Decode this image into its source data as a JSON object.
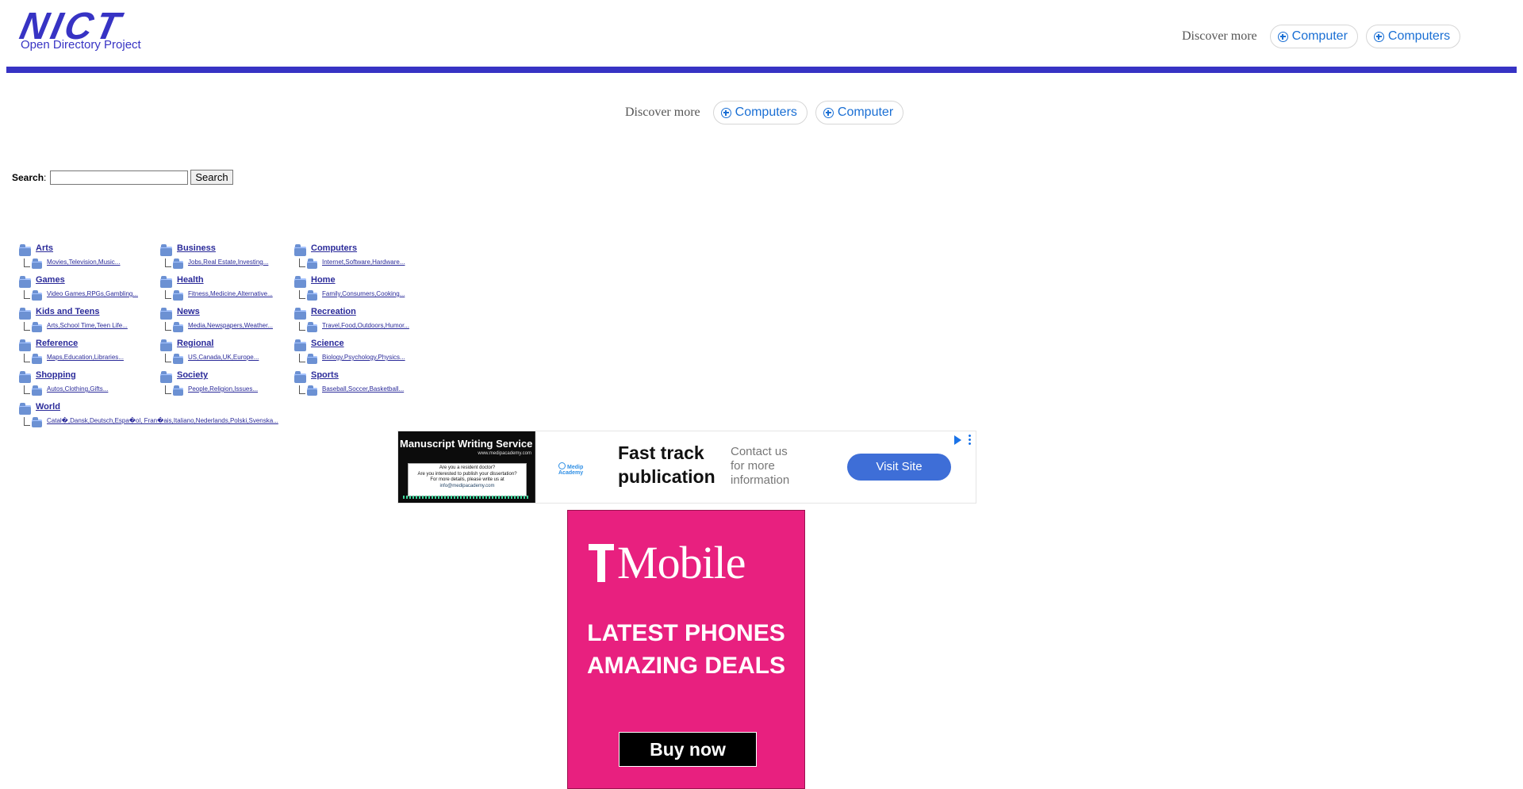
{
  "logo": {
    "wordmark": "NICT",
    "subtitle": "Open Directory Project"
  },
  "discover_top": {
    "label": "Discover more",
    "chips": [
      "Computer",
      "Computers"
    ]
  },
  "discover_mid": {
    "label": "Discover more",
    "chips": [
      "Computers",
      "Computer"
    ]
  },
  "search": {
    "label": "Search",
    "colon": ":",
    "input_value": "",
    "button": "Search"
  },
  "categories": [
    {
      "title": "Arts",
      "subs": "Movies,Television,Music..."
    },
    {
      "title": "Business",
      "subs": "Jobs,Real Estate,Investing..."
    },
    {
      "title": "Computers",
      "subs": "Internet,Software,Hardware..."
    },
    {
      "title": "Games",
      "subs": "Video Games,RPGs,Gambling..."
    },
    {
      "title": "Health",
      "subs": "Fitness,Medicine,Alternative..."
    },
    {
      "title": "Home",
      "subs": "Family,Consumers,Cooking..."
    },
    {
      "title": "Kids and Teens",
      "subs": "Arts,School Time,Teen Life..."
    },
    {
      "title": "News",
      "subs": "Media,Newspapers,Weather..."
    },
    {
      "title": "Recreation",
      "subs": "Travel,Food,Outdoors,Humor..."
    },
    {
      "title": "Reference",
      "subs": "Maps,Education,Libraries..."
    },
    {
      "title": "Regional",
      "subs": "US,Canada,UK,Europe..."
    },
    {
      "title": "Science",
      "subs": "Biology,Psychology,Physics..."
    },
    {
      "title": "Shopping",
      "subs": "Autos,Clothing,Gifts..."
    },
    {
      "title": "Society",
      "subs": "People,Religion,Issues..."
    },
    {
      "title": "Sports",
      "subs": "Baseball,Soccer,Basketball..."
    },
    {
      "title": "World",
      "subs": "Catal�,Dansk,Deutsch,Espa�ol, Fran�ais,Italiano,Nederlands,Polski,Svenska..."
    }
  ],
  "ad_banner": {
    "thumb_title": "Manuscript Writing Service",
    "thumb_url": "www.medipacademy.com",
    "thumb_lines": [
      "Are you a resident doctor?",
      "Are you interested to publish your dissertation?",
      "For more details, please write us at",
      "info@medipacademy.com"
    ],
    "small_logo": "Medip Academy",
    "headline": "Fast track publication",
    "description": "Contact us for more information",
    "cta": "Visit Site",
    "adchoices_icon": "adchoices-icon",
    "menu_icon": "kebab-icon"
  },
  "tmobile_ad": {
    "brand": "Mobile",
    "headline_1": "LATEST PHONES",
    "headline_2": "AMAZING DEALS",
    "cta": "Buy now"
  },
  "colors": {
    "brand_blue": "#3733c4",
    "link_blue": "#1a6fd4",
    "tmobile_magenta": "#e8207f",
    "ad_button": "#3e6ed7"
  }
}
